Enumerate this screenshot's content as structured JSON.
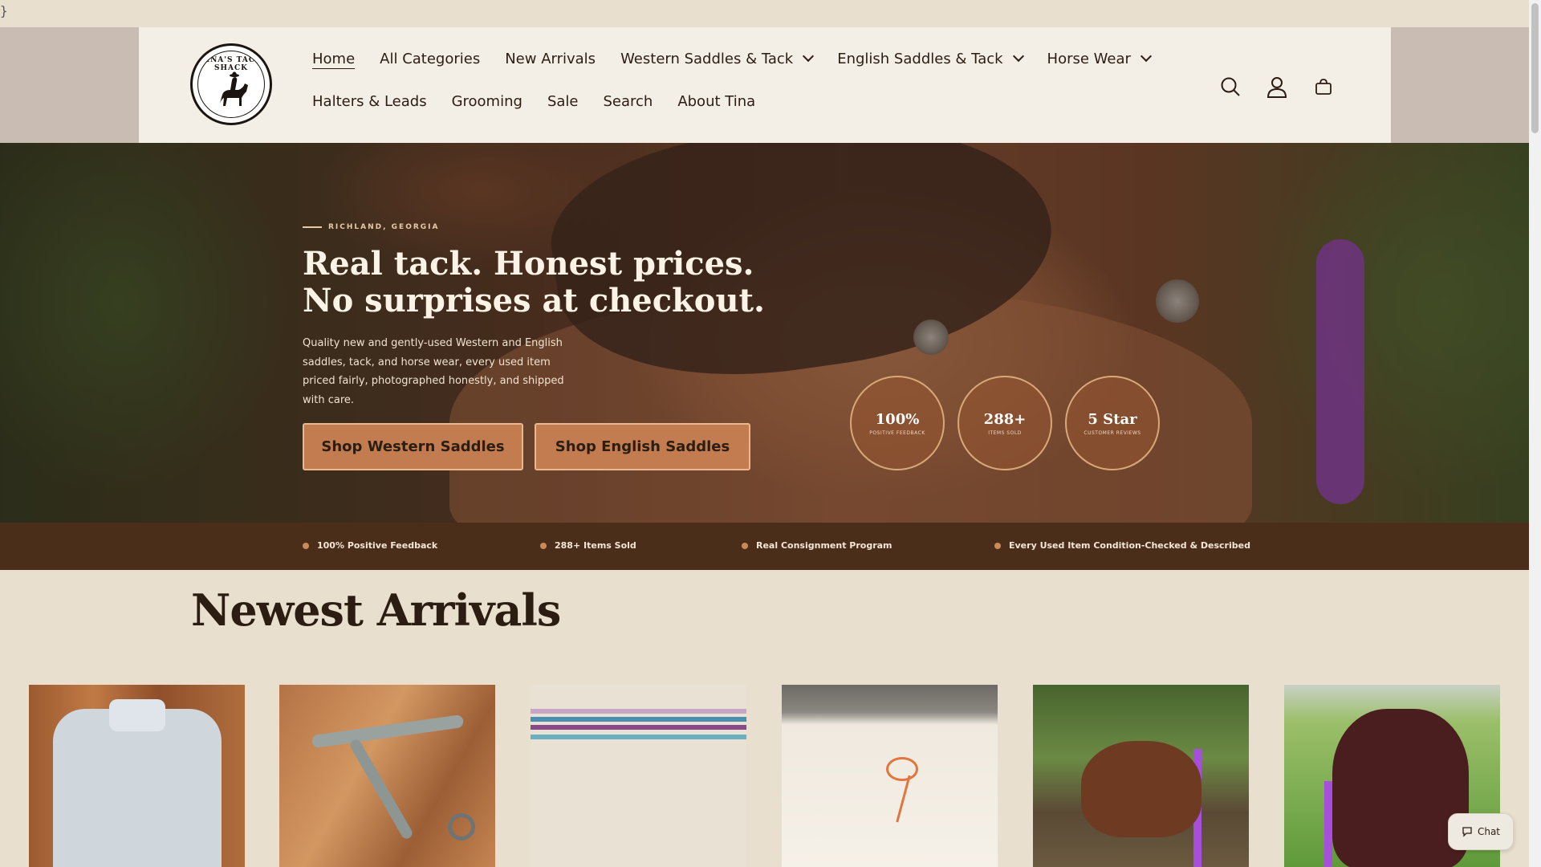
{
  "stray_char": "}",
  "header": {
    "logo_text": "TINA'S TACK SHACK",
    "nav_row1": [
      {
        "label": "Home",
        "active": true,
        "dropdown": false
      },
      {
        "label": "All Categories",
        "dropdown": false
      },
      {
        "label": "New Arrivals",
        "dropdown": false
      },
      {
        "label": "Western Saddles & Tack",
        "dropdown": true
      },
      {
        "label": "English Saddles & Tack",
        "dropdown": true
      },
      {
        "label": "Horse Wear",
        "dropdown": true
      }
    ],
    "nav_row2": [
      {
        "label": "Halters & Leads"
      },
      {
        "label": "Grooming"
      },
      {
        "label": "Sale"
      },
      {
        "label": "Search"
      },
      {
        "label": "About Tina"
      }
    ],
    "icons": [
      "search-icon",
      "account-icon",
      "cart-icon"
    ]
  },
  "hero": {
    "eyebrow": "RICHLAND, GEORGIA",
    "title": "Real tack. Honest prices. No surprises at checkout.",
    "subtitle": "Quality new and gently-used Western and English saddles, tack, and horse wear, every used item priced fairly, photographed honestly, and shipped with care.",
    "buttons": {
      "western": "Shop Western Saddles",
      "english": "Shop English Saddles"
    },
    "stats": [
      {
        "value": "100%",
        "label": "POSITIVE FEEDBACK"
      },
      {
        "value": "288+",
        "label": "ITEMS SOLD"
      },
      {
        "value": "5 Star",
        "label": "CUSTOMER REVIEWS"
      }
    ]
  },
  "trust_bar": [
    "100% Positive Feedback",
    "288+ Items Sold",
    "Real Consignment Program",
    "Every Used Item Condition-Checked & Described"
  ],
  "arrivals": {
    "title": "Newest Arrivals"
  },
  "chat": {
    "label": "Chat"
  },
  "colors": {
    "page_bg": "#e9dfcf",
    "header_bg": "#f4efe6",
    "accent_button": "#c27c4f",
    "trust_bar_bg": "#4a2e1a"
  }
}
